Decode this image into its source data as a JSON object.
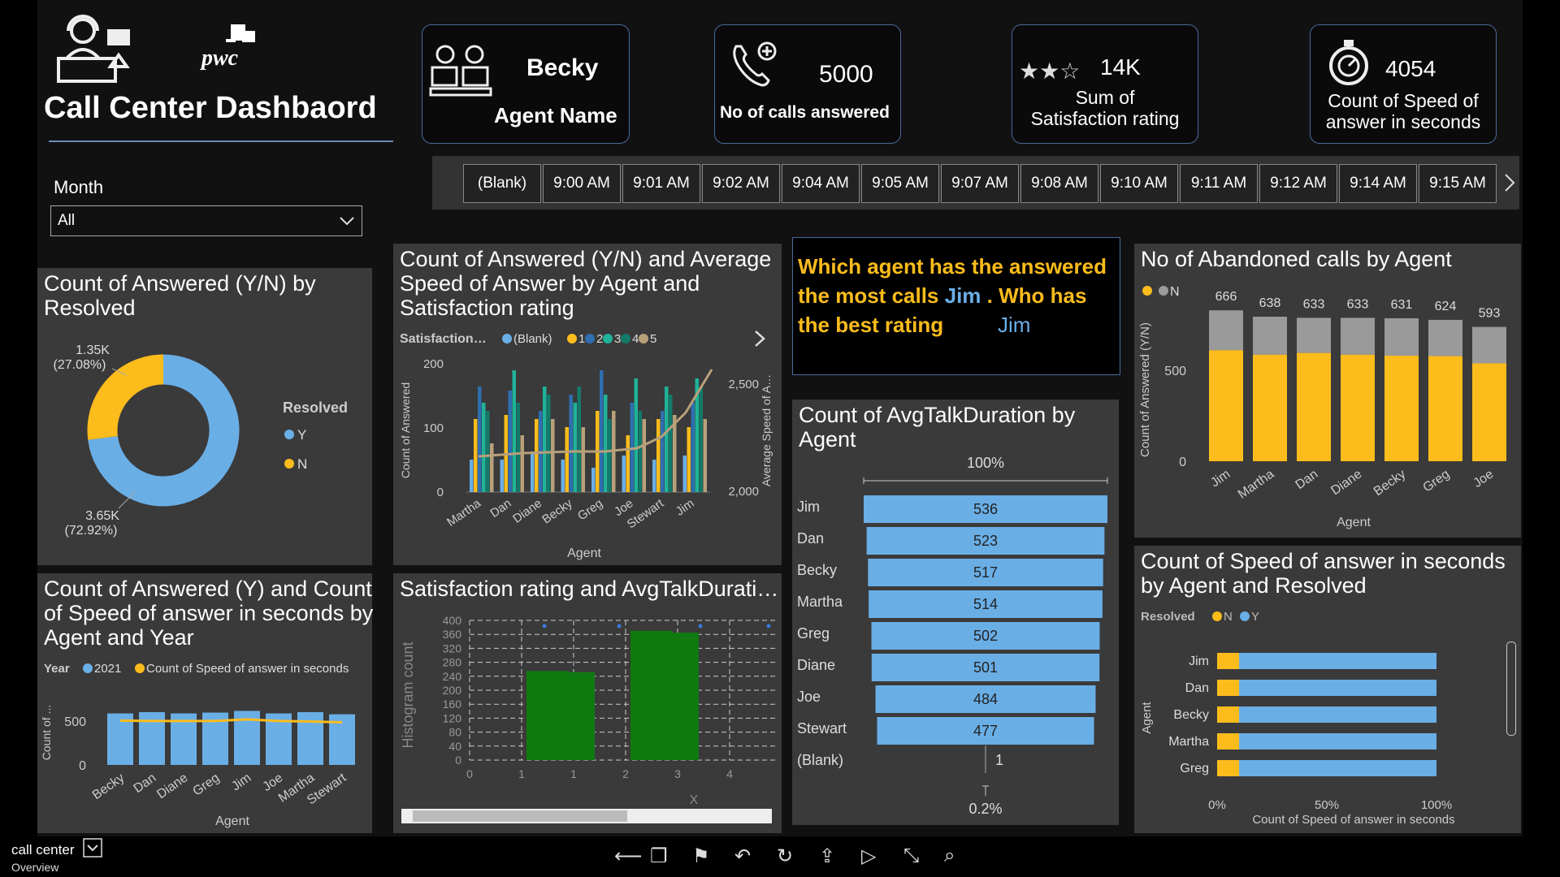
{
  "header": {
    "title": "Call Center Dashbaord",
    "brand": "pwc"
  },
  "kpis": {
    "agent": {
      "value": "Becky",
      "label": "Agent Name"
    },
    "calls": {
      "value": "5000",
      "label": "No of calls answered"
    },
    "rating": {
      "value": "14K",
      "label1": "Sum of",
      "label2": "Satisfaction rating"
    },
    "speed": {
      "value": "4054",
      "label1": "Count of Speed of",
      "label2": "answer in seconds"
    }
  },
  "month_filter": {
    "label": "Month",
    "value": "All"
  },
  "time_slicer": [
    "(Blank)",
    "9:00 AM",
    "9:01 AM",
    "9:02 AM",
    "9:04 AM",
    "9:05 AM",
    "9:07 AM",
    "9:08 AM",
    "9:10 AM",
    "9:11 AM",
    "9:12 AM",
    "9:14 AM",
    "9:15 AM"
  ],
  "qa": {
    "q1": "Which agent has the answered",
    "q2a": "the most calls ",
    "q2b": "Jim",
    "q2c": " . Who has",
    "q3": "the best rating",
    "a": "Jim"
  },
  "titles": {
    "donut": "Count of Answered (Y/N) by Resolved",
    "combo": "Count of Answered (Y/N) and Average Speed of Answer by Agent and Satisfaction rating",
    "abandoned": "No of Abandoned calls by Agent",
    "talk": "Count of AvgTalkDuration by Agent",
    "year": "Count of Answered (Y) and Count of Speed of answer in seconds by Agent and Year",
    "hist": "Satisfaction rating and AvgTalkDurati…",
    "speed": "Count of Speed of answer in seconds by Agent and Resolved"
  },
  "colors": {
    "blue": "#6aaee6",
    "yellow": "#fbbc1c",
    "gray": "#9a9a9a",
    "green": "#0f7a0f",
    "teal": "#1fb39a",
    "dteal": "#137a6a",
    "tan": "#b8a07a",
    "dblue": "#2f6fb0"
  },
  "chart_data": [
    {
      "type": "pie",
      "title": "Count of Answered (Y/N) by Resolved",
      "legend_title": "Resolved",
      "categories": [
        "Y",
        "N"
      ],
      "values": [
        3650,
        1350
      ],
      "labels": [
        "3.65K",
        "1.35K"
      ],
      "pcts": [
        "(72.92%)",
        "(27.08%)"
      ]
    },
    {
      "type": "bar",
      "title": "Count of Answered (Y/N) and Average Speed of Answer by Agent and Satisfaction rating",
      "legend_title": "Satisfaction…",
      "series_names": [
        "(Blank)",
        "1",
        "2",
        "3",
        "4",
        "5"
      ],
      "categories": [
        "Martha",
        "Dan",
        "Diane",
        "Becky",
        "Greg",
        "Joe",
        "Stewart",
        "Jim"
      ],
      "xlabel": "Agent",
      "ylabel": "Count of Answered",
      "y2label": "Average Speed of A…",
      "yticks": [
        "0",
        "100",
        "200"
      ],
      "y2ticks": [
        "2,000",
        "2,500"
      ]
    },
    {
      "type": "bar",
      "title": "No of Abandoned calls by Agent",
      "legend": [
        "Y",
        "N"
      ],
      "categories": [
        "Jim",
        "Martha",
        "Dan",
        "Diane",
        "Becky",
        "Greg",
        "Joe"
      ],
      "totals": [
        666,
        638,
        633,
        633,
        631,
        624,
        593
      ],
      "labels": [
        "666",
        "638",
        "633",
        "633",
        "631",
        "624",
        "593"
      ],
      "y_values": [
        490,
        470,
        478,
        470,
        466,
        464,
        432
      ],
      "xlabel": "Agent",
      "ylabel": "Count of Answered (Y/N)",
      "yticks": [
        "0",
        "500"
      ],
      "ylim": [
        0,
        700
      ]
    },
    {
      "type": "bar",
      "title": "Count of AvgTalkDuration by Agent",
      "categories": [
        "Jim",
        "Dan",
        "Becky",
        "Martha",
        "Greg",
        "Diane",
        "Joe",
        "Stewart",
        "(Blank)"
      ],
      "values": [
        536,
        523,
        517,
        514,
        502,
        501,
        484,
        477,
        1
      ],
      "labels": [
        "536",
        "523",
        "517",
        "514",
        "502",
        "501",
        "484",
        "477",
        "1"
      ],
      "top_label": "100%",
      "bottom_label": "0.2%"
    },
    {
      "type": "bar",
      "title": "Count of Answered (Y) and Count of Speed of answer in seconds by Agent and Year",
      "legend_title": "Year",
      "legend": [
        "2021",
        "Count of Speed of answer in seconds"
      ],
      "categories": [
        "Becky",
        "Dan",
        "Diane",
        "Greg",
        "Jim",
        "Joe",
        "Martha",
        "Stewart"
      ],
      "values": [
        610,
        625,
        610,
        620,
        640,
        610,
        625,
        600
      ],
      "line": [
        525,
        520,
        520,
        520,
        540,
        520,
        515,
        505
      ],
      "xlabel": "Agent",
      "ylabel": "Count of ...",
      "yticks": [
        "0",
        "500"
      ]
    },
    {
      "type": "bar",
      "title": "Satisfaction rating and AvgTalkDurati…",
      "ylabel": "Histogram count",
      "xlabel": "X",
      "yticks": [
        "0",
        "40",
        "80",
        "120",
        "160",
        "200",
        "240",
        "280",
        "320",
        "360",
        "400"
      ],
      "xticks": [
        "0",
        "1",
        "1",
        "2",
        "3",
        "4"
      ],
      "bars": [
        {
          "x": 1.5,
          "value": 255
        },
        {
          "x": 2.0,
          "value": 252
        },
        {
          "x": 3.5,
          "value": 370
        },
        {
          "x": 4.0,
          "value": 365
        }
      ]
    },
    {
      "type": "bar",
      "title": "Count of Speed of answer in seconds by Agent and Resolved",
      "legend_title": "Resolved",
      "legend": [
        "N",
        "Y"
      ],
      "categories": [
        "Jim",
        "Dan",
        "Becky",
        "Martha",
        "Greg"
      ],
      "n_pct": [
        0.1,
        0.1,
        0.1,
        0.1,
        0.1
      ],
      "xticks": [
        "0%",
        "50%",
        "100%"
      ],
      "xlabel": "Count of Speed of answer in seconds",
      "ylabel": "Agent"
    }
  ],
  "footer": {
    "name": "call center",
    "page": "Overview"
  }
}
